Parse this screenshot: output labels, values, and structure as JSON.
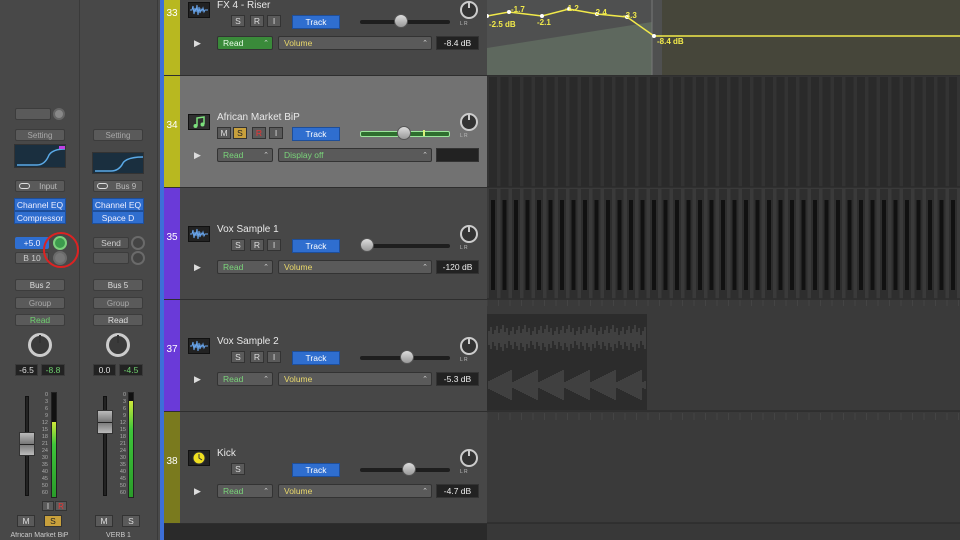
{
  "mixer": {
    "strips": [
      {
        "setting": "Setting",
        "input": "Input",
        "plugins": [
          "Channel EQ",
          "Compressor"
        ],
        "send_value": "+5.0",
        "send_bus": "B 10",
        "output": "Bus 2",
        "group": "Group",
        "automation": "Read",
        "pan_value": "-6.5",
        "peak_value": "-8.8",
        "mute": "M",
        "solo": "S",
        "input_monitor": "I",
        "record": "R",
        "name": "African Market BiP",
        "meter_level": 0.72
      },
      {
        "setting": "Setting",
        "input": "Bus 9",
        "plugins": [
          "Channel EQ",
          "Space D"
        ],
        "send_label": "Send",
        "output": "Bus 5",
        "group": "Group",
        "automation": "Read",
        "pan_value": "0.0",
        "peak_value": "-4.5",
        "mute": "M",
        "solo": "S",
        "name": "VERB 1",
        "meter_level": 0.92
      }
    ],
    "scale_labels": [
      "0",
      "3",
      "6",
      "9",
      "12",
      "15",
      "18",
      "21",
      "24",
      "30",
      "35",
      "40",
      "45",
      "50",
      "60"
    ]
  },
  "tracks": [
    {
      "number": "33",
      "name": "FX 4 - Riser",
      "color": "#b8b820",
      "buttons": [
        "S",
        "R",
        "I"
      ],
      "track_button": "Track",
      "mode": "Read",
      "param": "Volume",
      "value": "-8.4 dB",
      "volume": 0.45,
      "icon": "waveform-icon"
    },
    {
      "number": "34",
      "name": "African Market BiP",
      "color": "#b8b820",
      "buttons": [
        "M",
        "S",
        "R",
        "I"
      ],
      "track_button": "Track",
      "mode": "Read",
      "param": "Display off",
      "value": "",
      "volume": 0.48,
      "icon": "music-note-icon"
    },
    {
      "number": "35",
      "name": "Vox Sample 1",
      "color": "#6a3ad8",
      "buttons": [
        "S",
        "R",
        "I"
      ],
      "track_button": "Track",
      "mode": "Read",
      "param": "Volume",
      "value": "-120 dB",
      "volume": 0.0,
      "icon": "waveform-icon"
    },
    {
      "number": "37",
      "name": "Vox Sample 2",
      "color": "#6a3ad8",
      "buttons": [
        "S",
        "R",
        "I"
      ],
      "track_button": "Track",
      "mode": "Read",
      "param": "Volume",
      "value": "-5.3 dB",
      "volume": 0.52,
      "icon": "waveform-icon"
    },
    {
      "number": "38",
      "name": "Kick",
      "color": "#7a7a1e",
      "buttons": [
        "S"
      ],
      "track_button": "Track",
      "mode": "Read",
      "param": "Volume",
      "value": "-4.7 dB",
      "volume": 0.55,
      "icon": "drum-icon"
    }
  ],
  "pan_lr": "L  R",
  "automation_points": [
    "-2.5 dB",
    "-1.7",
    "-2.1",
    "-1.2",
    "-2.4",
    "-3.3",
    "-8.4 dB"
  ]
}
